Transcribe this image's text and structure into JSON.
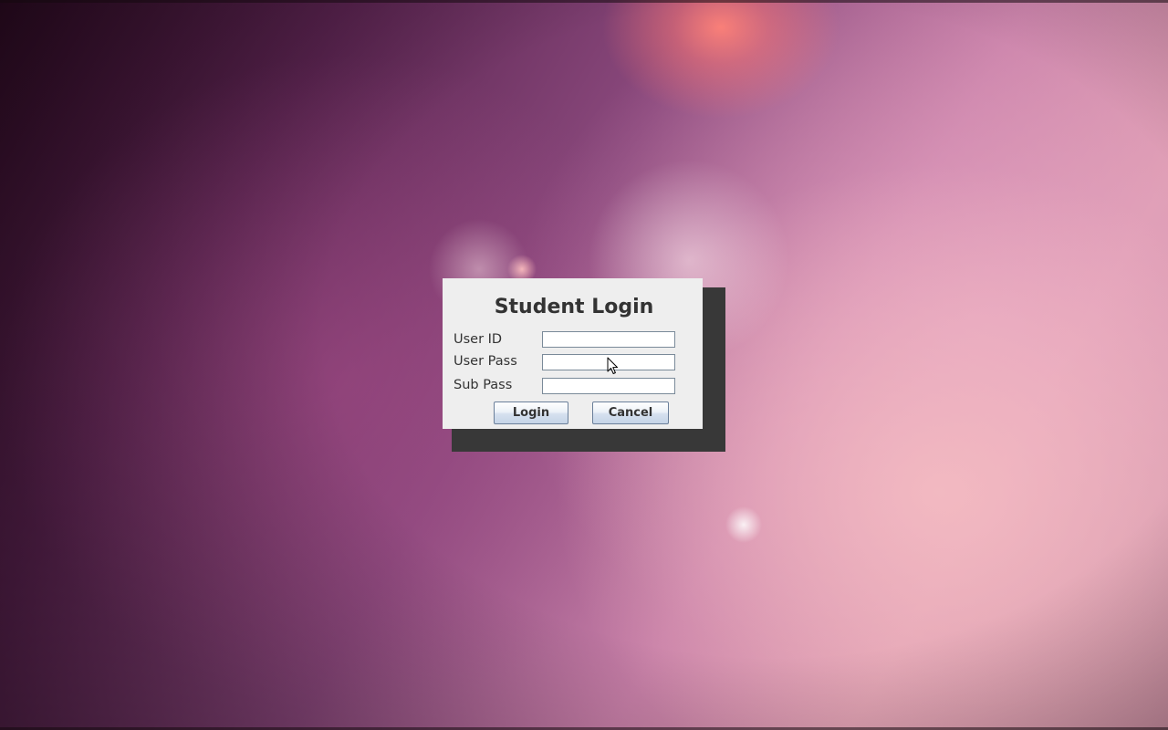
{
  "dialog": {
    "title": "Student Login",
    "fields": [
      {
        "label": "User ID",
        "value": ""
      },
      {
        "label": "User Pass",
        "value": ""
      },
      {
        "label": "Sub Pass",
        "value": ""
      }
    ],
    "buttons": {
      "login_label": "Login",
      "cancel_label": "Cancel"
    }
  },
  "icons": {
    "cursor": "mouse-pointer-icon"
  },
  "colors": {
    "dialog_background": "#eeeeee",
    "button_gradient_top": "#ffffff",
    "button_gradient_bottom": "#c5d4e7",
    "text": "#333333",
    "shadow_window": "#383838"
  }
}
